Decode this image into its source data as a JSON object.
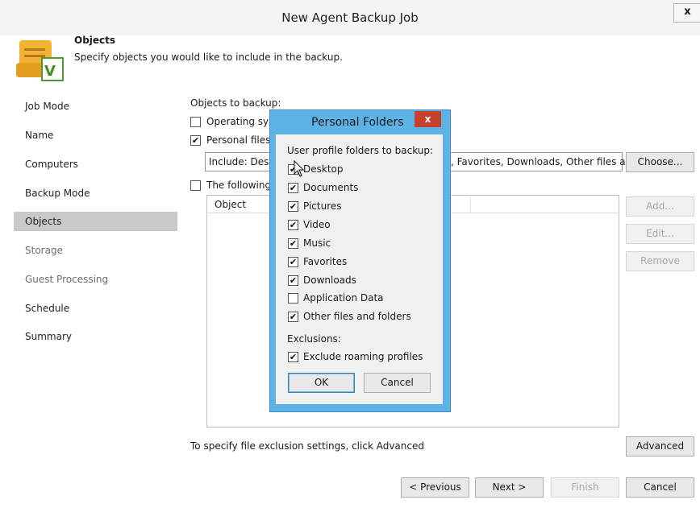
{
  "window": {
    "title": "New Agent Backup Job",
    "close_label": "x"
  },
  "header": {
    "title": "Objects",
    "subtitle": "Specify objects you would like to include in the backup.",
    "icon_letter": "V"
  },
  "nav": {
    "items": [
      {
        "label": "Job Mode"
      },
      {
        "label": "Name"
      },
      {
        "label": "Computers"
      },
      {
        "label": "Backup Mode"
      },
      {
        "label": "Objects"
      },
      {
        "label": "Storage"
      },
      {
        "label": "Guest Processing"
      },
      {
        "label": "Schedule"
      },
      {
        "label": "Summary"
      }
    ]
  },
  "main": {
    "section_label": "Objects to backup:",
    "os_label": "Operating sys",
    "personal_label": "Personal files",
    "include_value": "Include: Desk",
    "include_tail": ", Favorites, Downloads, Other files ar",
    "choose_label": "Choose...",
    "following_label": "The following",
    "object_column": "Object",
    "add_label": "Add...",
    "edit_label": "Edit...",
    "remove_label": "Remove",
    "exclusion_hint": "To specify file exclusion settings, click Advanced",
    "advanced_label": "Advanced"
  },
  "footer": {
    "previous_label": "< Previous",
    "next_label": "Next >",
    "finish_label": "Finish",
    "cancel_label": "Cancel"
  },
  "dialog": {
    "title": "Personal Folders",
    "close_label": "x",
    "section_label": "User profile folders to backup:",
    "folders": [
      {
        "label": "Desktop",
        "checked": true
      },
      {
        "label": "Documents",
        "checked": true
      },
      {
        "label": "Pictures",
        "checked": true
      },
      {
        "label": "Video",
        "checked": true
      },
      {
        "label": "Music",
        "checked": true
      },
      {
        "label": "Favorites",
        "checked": true
      },
      {
        "label": "Downloads",
        "checked": true
      },
      {
        "label": "Application Data",
        "checked": false
      },
      {
        "label": "Other files and folders",
        "checked": true
      }
    ],
    "exclusions_label": "Exclusions:",
    "exclude_roaming_label": "Exclude roaming profiles",
    "ok_label": "OK",
    "cancel_label": "Cancel"
  },
  "check_glyph": "✔"
}
